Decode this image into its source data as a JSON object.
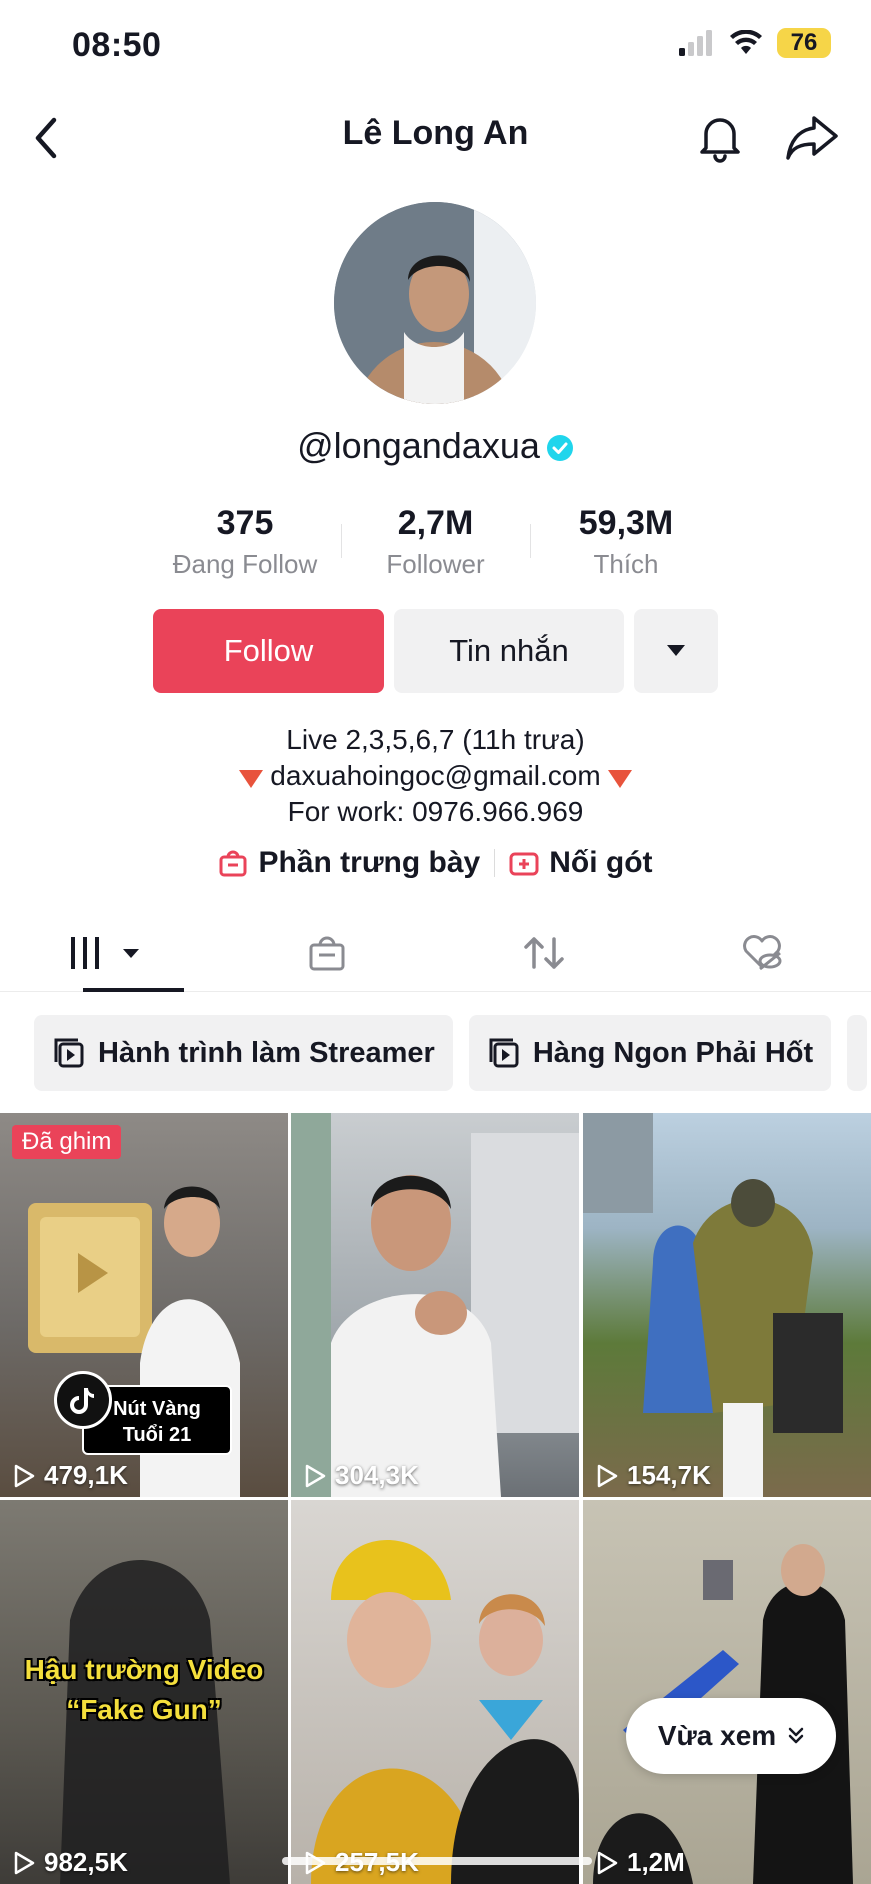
{
  "status_bar": {
    "time": "08:50",
    "battery": "76"
  },
  "header": {
    "title": "Lê Long An"
  },
  "profile": {
    "username": "@longandaxua",
    "verified": true,
    "stats": [
      {
        "value": "375",
        "label": "Đang Follow"
      },
      {
        "value": "2,7M",
        "label": "Follower"
      },
      {
        "value": "59,3M",
        "label": "Thích"
      }
    ],
    "buttons": {
      "follow": "Follow",
      "message": "Tin nhắn"
    },
    "bio": [
      "Live 2,3,5,6,7 (11h trưa)",
      "daxuahoingoc@gmail.com",
      "For work: 0976.966.969"
    ],
    "links": {
      "showcase": "Phần trưng bày",
      "add_yours": "Nối gót"
    }
  },
  "tabs": [
    "videos-tab",
    "shop-tab",
    "reposts-tab",
    "liked-tab"
  ],
  "playlists": [
    {
      "label": "Hành trình làm Streamer"
    },
    {
      "label": "Hàng Ngon Phải Hốt"
    }
  ],
  "videos": [
    {
      "views": "479,1K",
      "pinned_label": "Đã ghim",
      "badge": [
        "Nút Vàng",
        "Tuổi 21"
      ]
    },
    {
      "views": "304,3K"
    },
    {
      "views": "154,7K"
    },
    {
      "views": "982,5K",
      "overlay": [
        "Hậu trường Video",
        "“Fake Gun”"
      ]
    },
    {
      "views": "257,5K"
    },
    {
      "views": "1,2M"
    }
  ],
  "floating": {
    "label": "Vừa xem"
  },
  "colors": {
    "accent": "#ea4359",
    "verified": "#20d5ec"
  }
}
